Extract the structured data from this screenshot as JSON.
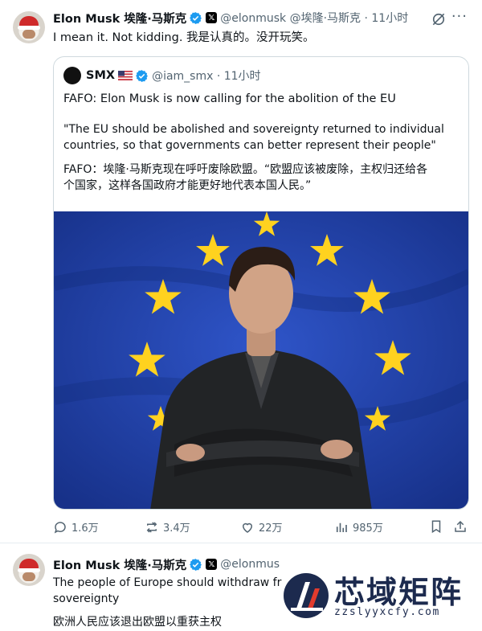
{
  "tweet1": {
    "author_name": "Elon Musk 埃隆·马斯克",
    "handle_time": "@elonmusk @埃隆·马斯克 · 11小时",
    "text": "I mean it. Not kidding. 我是认真的。没开玩笑。",
    "quote": {
      "author_name": "SMX",
      "handle_time": "@iam_smx · 11小时",
      "line1": "FAFO: Elon Musk is now calling for the abolition of the EU",
      "line2a": "\"The EU should be abolished and sovereignty returned to individual",
      "line2b": "countries, so that governments can better represent their people\"",
      "line3a": "FAFO：埃隆·马斯克现在呼吁废除欧盟。“欧盟应该被废除，主权归还给各",
      "line3b": "个国家，这样各国政府才能更好地代表本国人民。”"
    },
    "actions": {
      "replies": "1.6万",
      "reposts": "3.4万",
      "likes": "22万",
      "views": "985万"
    }
  },
  "tweet2": {
    "author_name": "Elon Musk 埃隆·马斯克",
    "handle": "@elonmus",
    "text_line1": "The people of Europe should withdraw fr",
    "text_line2": "sovereignty",
    "text_cn": "欧洲人民应该退出欧盟以重获主权"
  },
  "watermark": {
    "brand": "芯域矩阵",
    "url": "zzslyyxcfy.com"
  },
  "icons": [
    "verified-icon",
    "x-badge-icon",
    "grok-icon",
    "more-icon",
    "reply-icon",
    "repost-icon",
    "like-icon",
    "views-icon",
    "bookmark-icon",
    "share-icon",
    "us-flag-icon"
  ],
  "colors": {
    "accent": "#1d9bf0",
    "muted": "#536471",
    "eu_blue": "#1f3fa6",
    "eu_star": "#ffd21f"
  }
}
